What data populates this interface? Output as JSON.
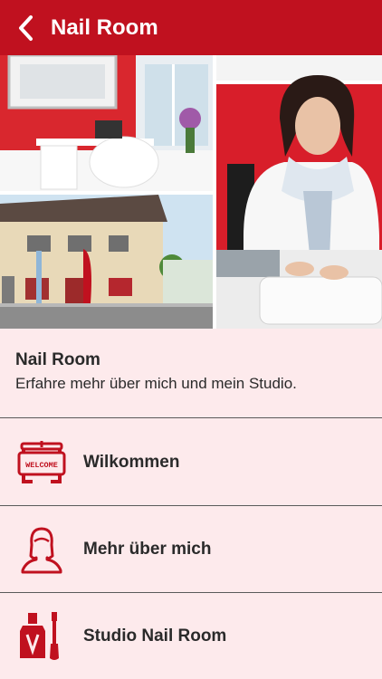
{
  "header": {
    "title": "Nail Room"
  },
  "intro": {
    "title": "Nail Room",
    "subtitle": "Erfahre mehr über mich und mein Studio."
  },
  "welcome_sign_text": "WELCOME",
  "menu": [
    {
      "label": "Wilkommen",
      "icon": "welcome-sign-icon"
    },
    {
      "label": "Mehr über mich",
      "icon": "woman-silhouette-icon"
    },
    {
      "label": "Studio Nail Room",
      "icon": "nail-polish-icon"
    }
  ],
  "colors": {
    "brand": "#c0111f",
    "background": "#fdeaec",
    "divider": "#5a5a5a"
  }
}
